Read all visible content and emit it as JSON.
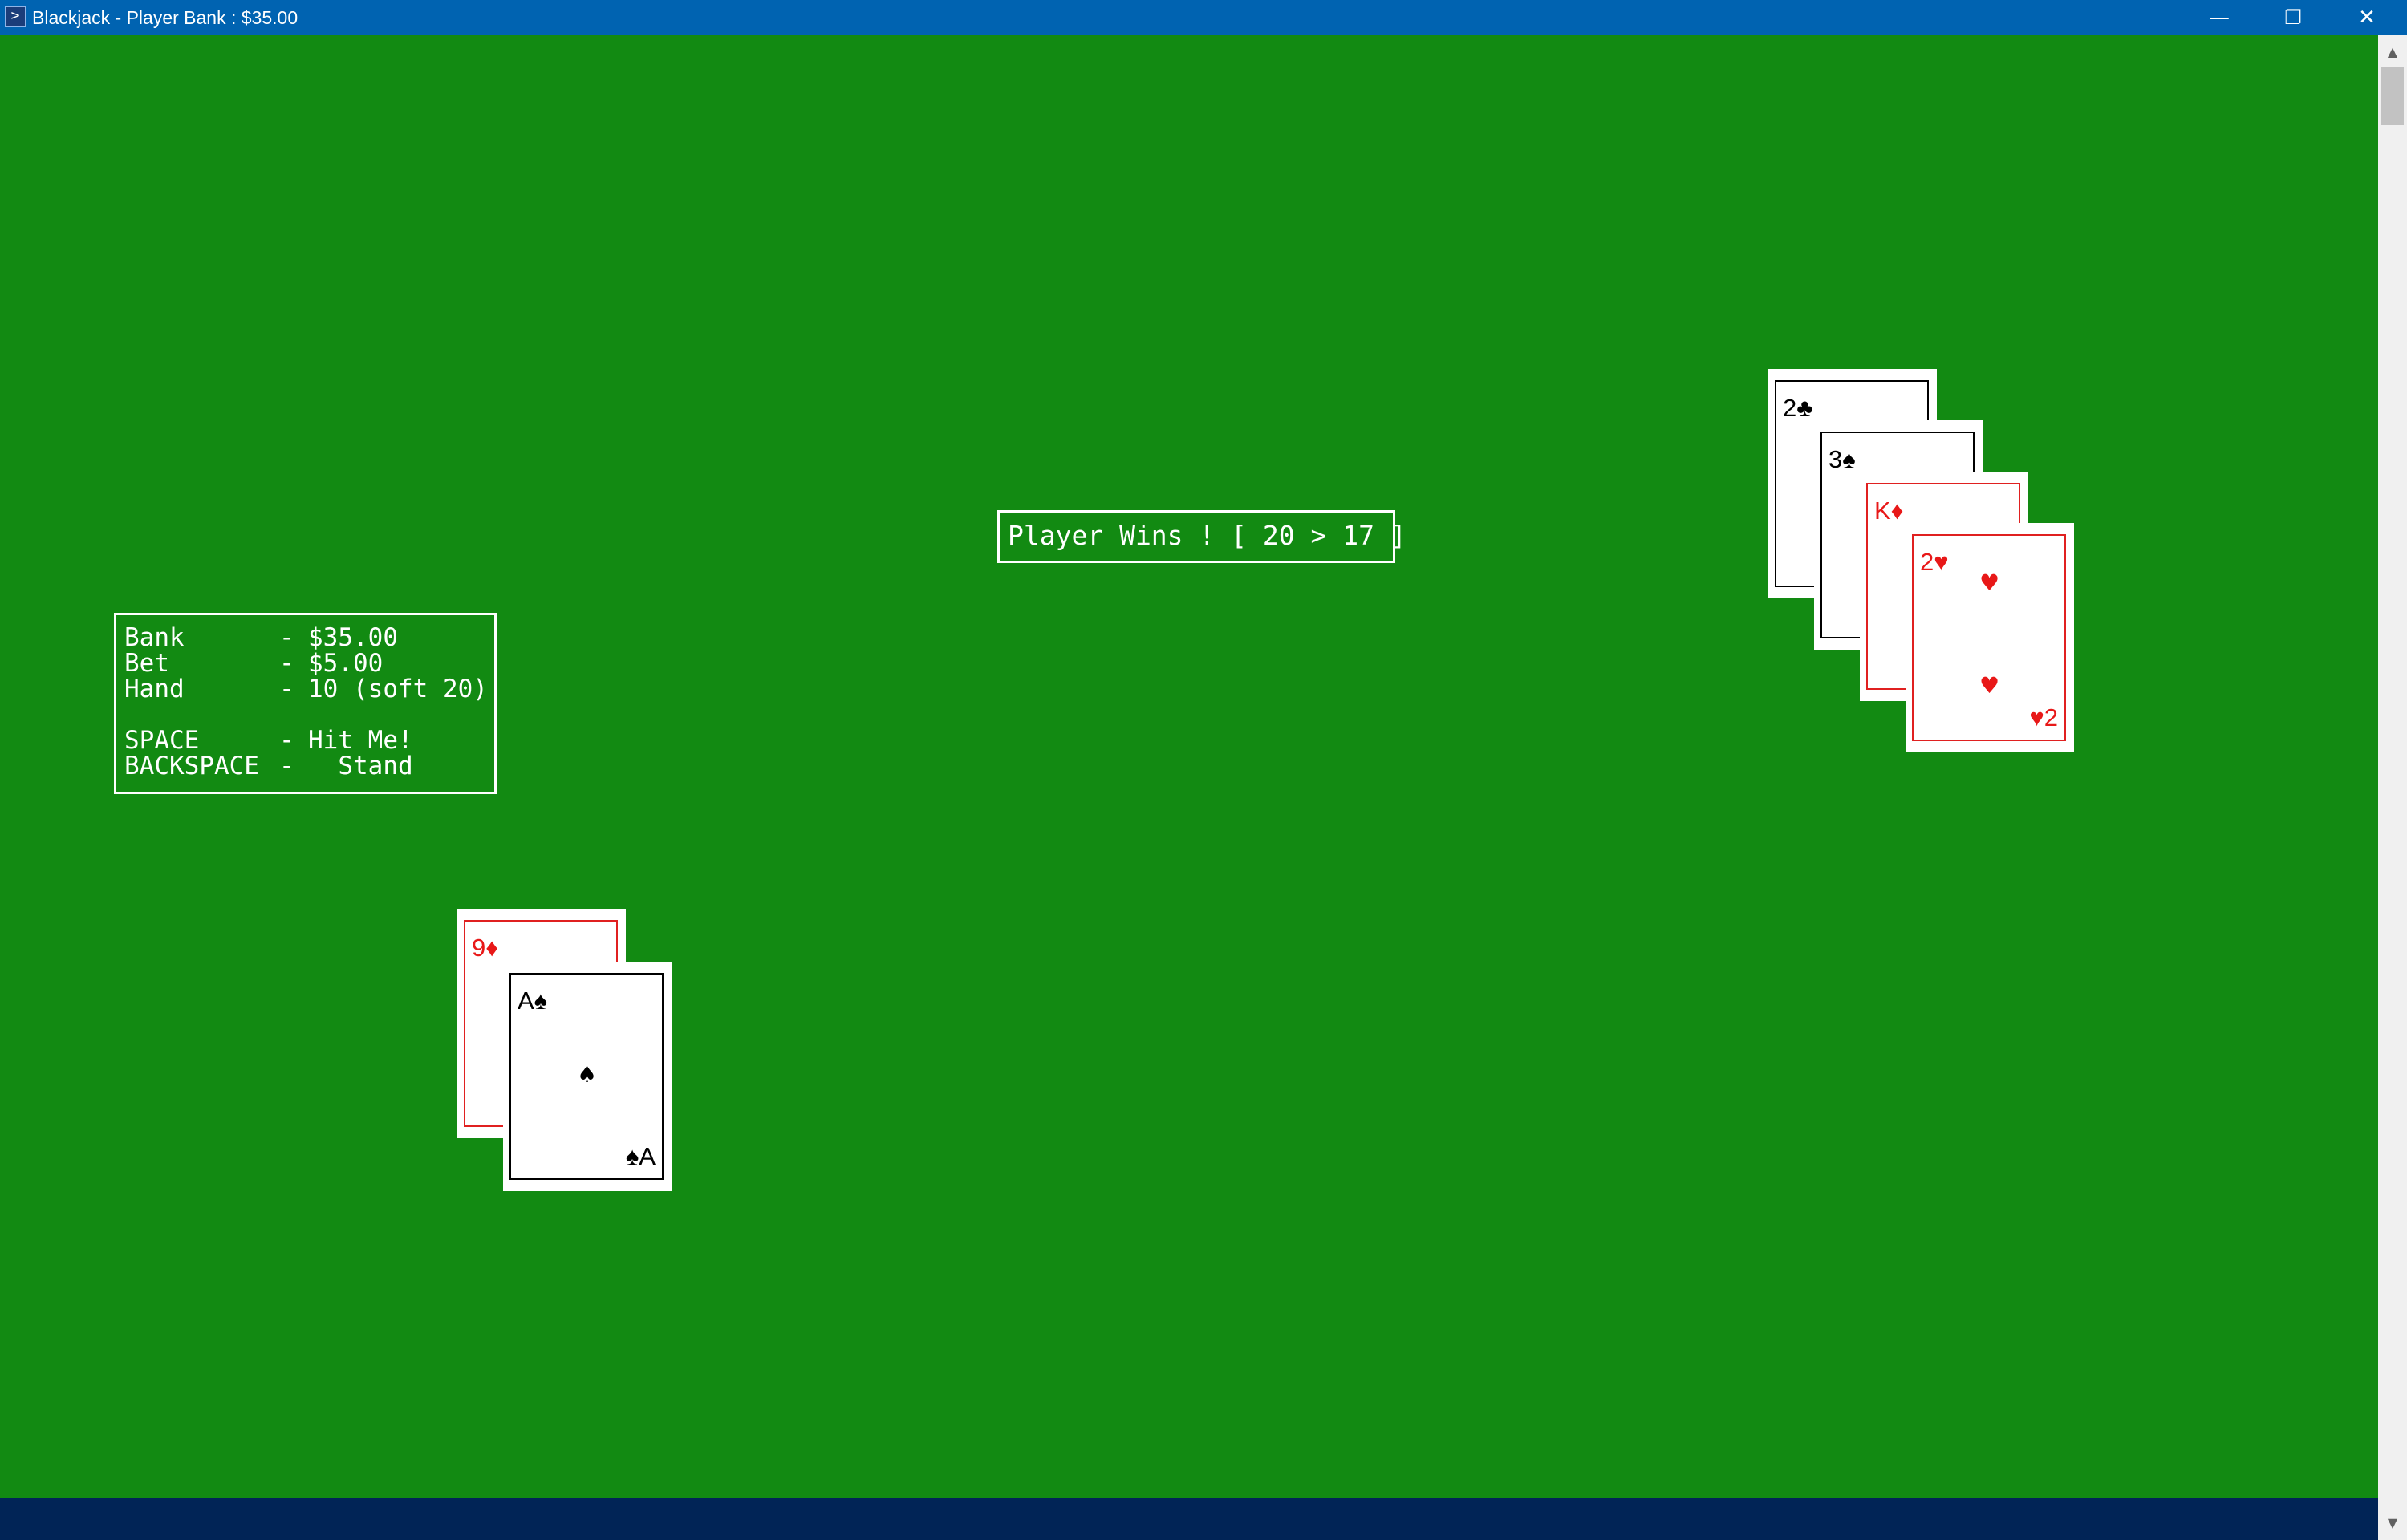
{
  "window": {
    "title": "Blackjack - Player Bank : $35.00",
    "icon": "powershell-icon",
    "controls": {
      "minimize": "—",
      "restore": "❐",
      "close": "✕"
    }
  },
  "status_message": "Player Wins ! [ 20 > 17 ]",
  "info_panel": {
    "bank_label": "Bank",
    "bank_value": "$35.00",
    "bet_label": "Bet",
    "bet_value": "$5.00",
    "hand_label": "Hand",
    "hand_value": "10 (soft 20)",
    "dash": "-",
    "space_key": "SPACE",
    "space_action": "Hit Me!",
    "backspace_key": "BACKSPACE",
    "backspace_action": "  Stand"
  },
  "dealer_hand": [
    {
      "rank": "2",
      "suit": "♣",
      "color": "#000000"
    },
    {
      "rank": "3",
      "suit": "♠",
      "color": "#000000"
    },
    {
      "rank": "K",
      "suit": "♦",
      "color": "#e81818"
    },
    {
      "rank": "2",
      "suit": "♥",
      "color": "#e81818"
    }
  ],
  "player_hand": [
    {
      "rank": "9",
      "suit": "♦",
      "color": "#e81818"
    },
    {
      "rank": "A",
      "suit": "♠",
      "color": "#000000"
    }
  ],
  "colors": {
    "table": "#128a12",
    "titlebar": "#0063b1",
    "console_footer": "#012456",
    "red_suit": "#e81818"
  }
}
